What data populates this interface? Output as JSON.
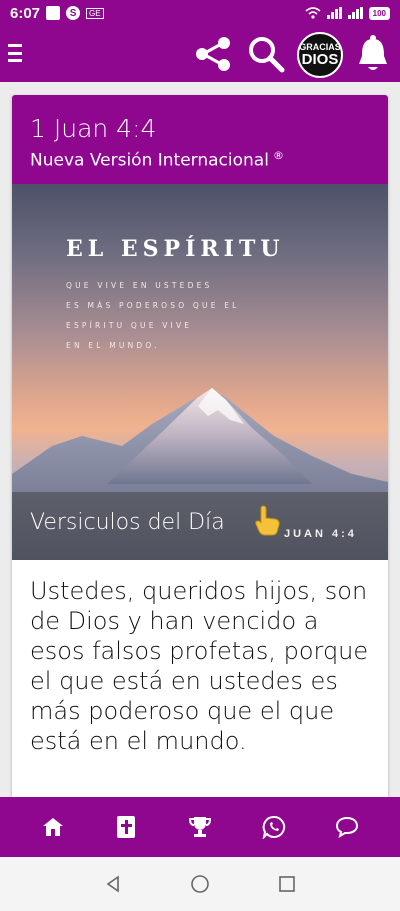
{
  "status": {
    "time": "6:07",
    "battery": "100",
    "ge_label": "GE",
    "s_label": "S"
  },
  "app": {
    "logo_line1": "GRACIAS",
    "logo_line2": "DIOS"
  },
  "verse": {
    "reference": "1 Juan 4:4",
    "version": "Nueva Versión Internacional",
    "registered": "®",
    "text": "Ustedes, queridos hijos, son de Dios y han vencido a esos falsos profetas, porque el que está en ustedes es más poderoso que el que está en el mundo."
  },
  "image": {
    "title": "EL ESPÍRITU",
    "body": "QUE VIVE EN USTEDES\nES MÁS PODEROSO QUE EL\nESPÍRITU QUE VIVE\nEN EL MUNDO.",
    "reference": "JUAN 4:4",
    "overlay_label": "Versiculos del Día"
  },
  "colors": {
    "brand": "#8e078e",
    "card": "#ffffff"
  },
  "icons": [
    "menu-icon",
    "share-icon",
    "search-icon",
    "logo",
    "bell-icon",
    "home-icon",
    "bible-icon",
    "trophy-icon",
    "whatsapp-icon",
    "chat-icon"
  ]
}
